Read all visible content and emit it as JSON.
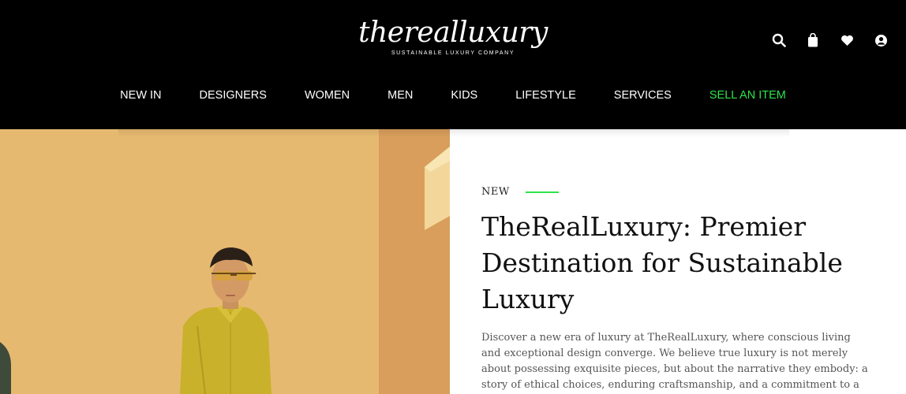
{
  "brand": {
    "logo": "therealluxury",
    "tagline": "SUSTAINABLE LUXURY COMPANY"
  },
  "header_icons": [
    "search-icon",
    "shopping-bag-icon",
    "heart-icon",
    "user-icon"
  ],
  "nav": {
    "items": [
      {
        "label": "NEW IN"
      },
      {
        "label": "DESIGNERS"
      },
      {
        "label": "WOMEN"
      },
      {
        "label": "MEN"
      },
      {
        "label": "KIDS"
      },
      {
        "label": "LIFESTYLE"
      },
      {
        "label": "SERVICES"
      },
      {
        "label": "SELL AN ITEM"
      }
    ]
  },
  "hero": {
    "eyebrow": "NEW",
    "headline": "TheRealLuxury: Premier Destination for Sustainable Luxury",
    "body": "Discover a new era of luxury at TheRealLuxury, where conscious living and exceptional design converge. We believe true luxury is not merely about possessing exquisite pieces, but about the narrative they embody: a story of ethical choices, enduring craftsmanship, and a commitment to a sustainable"
  },
  "colors": {
    "header_bg": "#000000",
    "accent": "#2ee34a",
    "hero_bg": "#e2b26a"
  }
}
